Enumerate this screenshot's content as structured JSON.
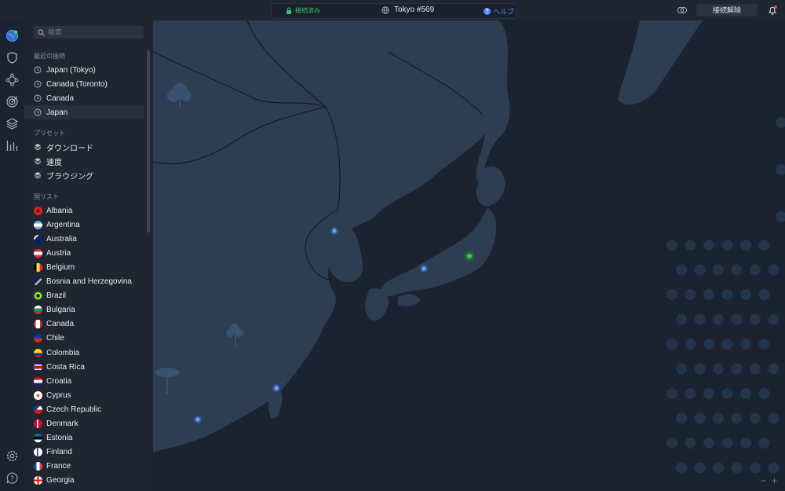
{
  "topbar": {
    "status": "接続済み",
    "server": "Tokyo #569",
    "help": "ヘルプ",
    "disconnect": "接続解除"
  },
  "search": {
    "placeholder": "検索"
  },
  "recent": {
    "title": "最近の接続",
    "items": [
      "Japan (Tokyo)",
      "Canada (Toronto)",
      "Canada",
      "Japan"
    ]
  },
  "presets": {
    "title": "プリセット",
    "items": [
      "ダウンロード",
      "速度",
      "ブラウジング"
    ]
  },
  "countries": {
    "title": "国リスト",
    "items": [
      "Albania",
      "Argentina",
      "Australia",
      "Austria",
      "Belgium",
      "Bosnia and Herzegovina",
      "Brazil",
      "Bulgaria",
      "Canada",
      "Chile",
      "Colombia",
      "Costa Rica",
      "Croatia",
      "Cyprus",
      "Czech Republic",
      "Denmark",
      "Estonia",
      "Finland",
      "France",
      "Georgia"
    ]
  },
  "map_controls": {
    "zoom_out": "−",
    "zoom_in": "+"
  },
  "colors": {
    "accent": "#4c8ef5",
    "connected": "#3fc46b",
    "land": "#2d3d52",
    "sea": "#1b2230"
  }
}
